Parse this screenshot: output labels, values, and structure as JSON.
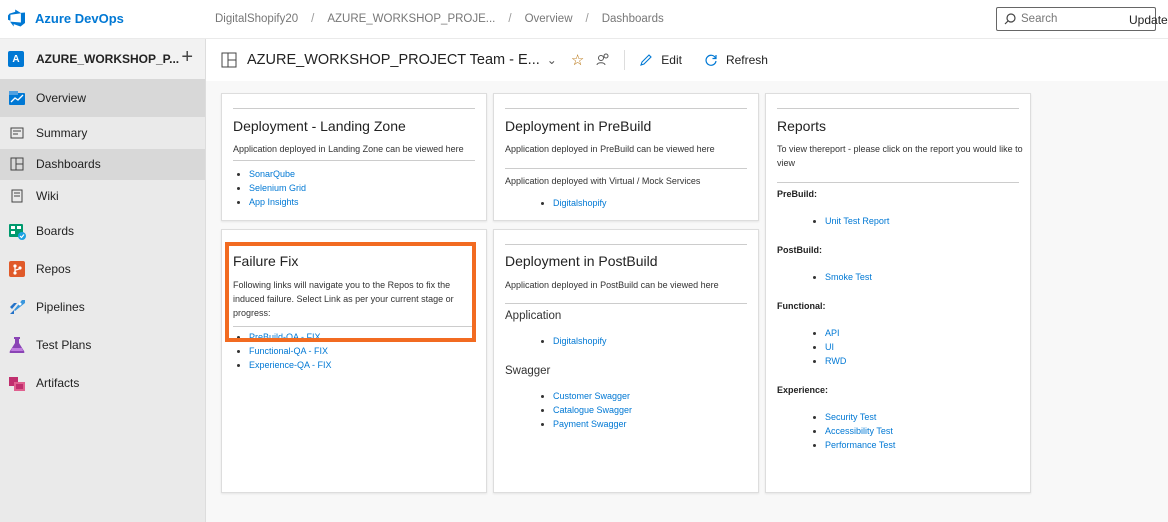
{
  "brand": {
    "name": "Azure DevOps"
  },
  "breadcrumb": [
    "DigitalShopify20",
    "AZURE_WORKSHOP_PROJE...",
    "Overview",
    "Dashboards"
  ],
  "search": {
    "placeholder": "Search"
  },
  "sidebar": {
    "project": {
      "avatar": "A",
      "name": "AZURE_WORKSHOP_P..."
    },
    "items": [
      {
        "label": "Overview",
        "icon": "overview-icon"
      },
      {
        "label": "Summary",
        "icon": "summary-icon"
      },
      {
        "label": "Dashboards",
        "icon": "dashboards-icon"
      },
      {
        "label": "Wiki",
        "icon": "wiki-icon"
      },
      {
        "label": "Boards",
        "icon": "boards-icon"
      },
      {
        "label": "Repos",
        "icon": "repos-icon"
      },
      {
        "label": "Pipelines",
        "icon": "pipelines-icon"
      },
      {
        "label": "Test Plans",
        "icon": "test-plans-icon"
      },
      {
        "label": "Artifacts",
        "icon": "artifacts-icon"
      }
    ]
  },
  "header": {
    "title": "AZURE_WORKSHOP_PROJECT Team - E...",
    "edit": "Edit",
    "refresh": "Refresh",
    "updated": "Updated"
  },
  "widgets": {
    "landing": {
      "title": "Deployment - Landing Zone",
      "desc": "Application deployed in Landing Zone can be viewed here",
      "links": [
        "SonarQube",
        "Selenium Grid",
        "App Insights"
      ]
    },
    "prebuild": {
      "title": "Deployment in PreBuild",
      "desc": "Application deployed in PreBuild can be viewed here",
      "note": "Application deployed with Virtual / Mock Services",
      "links": [
        "Digitalshopify"
      ]
    },
    "reports": {
      "title": "Reports",
      "desc": "To view thereport - please click on the report you would like to view",
      "sections": [
        {
          "label": "PreBuild:",
          "links": [
            "Unit Test Report"
          ]
        },
        {
          "label": "PostBuild:",
          "links": [
            "Smoke Test"
          ]
        },
        {
          "label": "Functional:",
          "links": [
            "API",
            "UI",
            "RWD"
          ]
        },
        {
          "label": "Experience:",
          "links": [
            "Security Test",
            "Accessibility Test",
            "Performance Test"
          ]
        }
      ]
    },
    "failure": {
      "title": "Failure Fix",
      "desc": "Following links will navigate you to the Repos to fix the induced failure. Select Link as per your current stage or progress:",
      "links": [
        "PreBuild-QA - FIX",
        "Functional-QA - FIX",
        "Experience-QA - FIX"
      ]
    },
    "postbuild": {
      "title": "Deployment in PostBuild",
      "desc": "Application deployed in PostBuild can be viewed here",
      "app_label": "Application",
      "app_links": [
        "Digitalshopify"
      ],
      "swagger_label": "Swagger",
      "swagger_links": [
        "Customer Swagger",
        "Catalogue Swagger",
        "Payment Swagger"
      ]
    }
  },
  "colors": {
    "accent": "#0078d4",
    "highlight": "#f26b21"
  }
}
